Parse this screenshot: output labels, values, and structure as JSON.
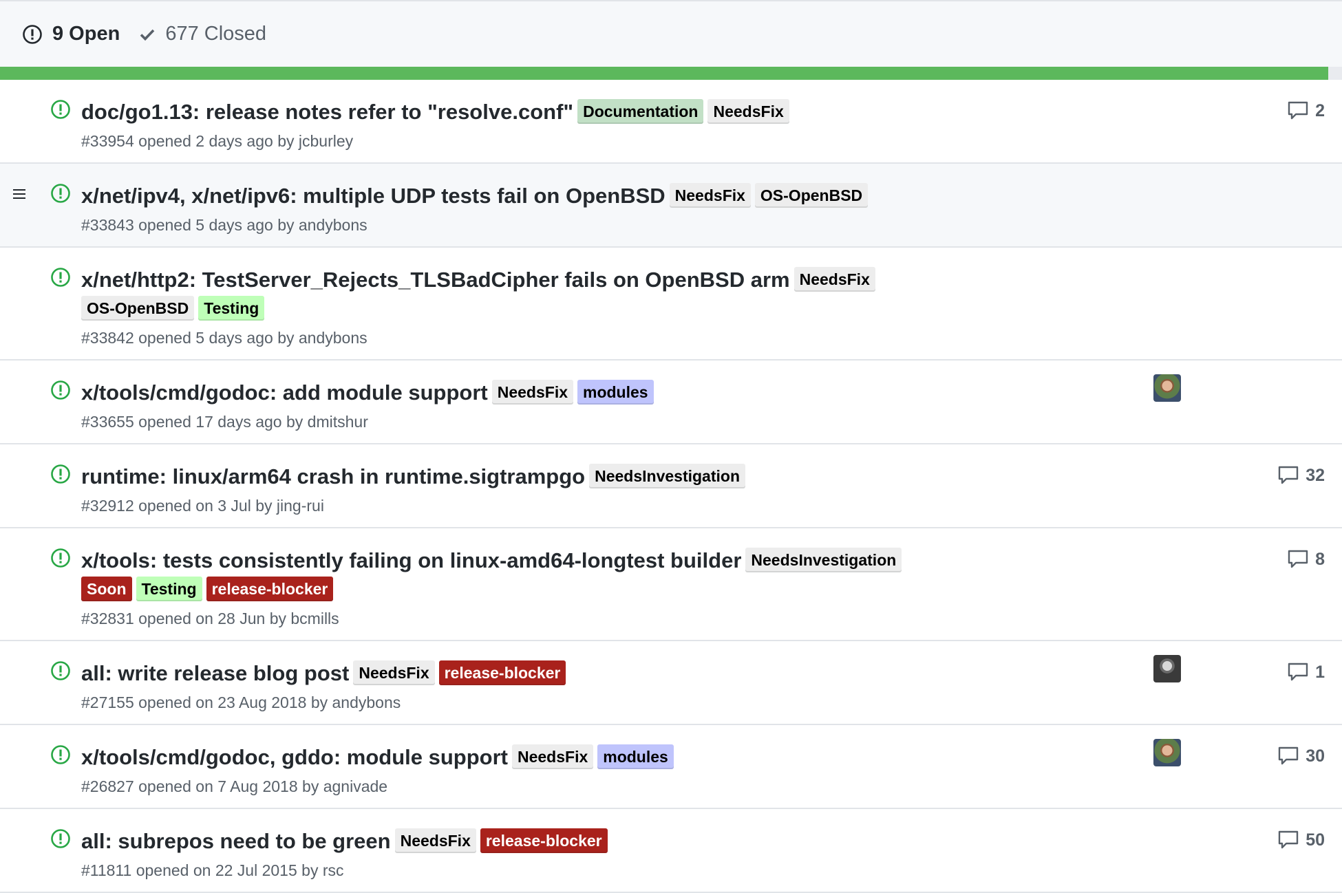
{
  "header": {
    "open_label": "9 Open",
    "closed_label": "677 Closed",
    "open_icon": "issue-opened-icon",
    "closed_icon": "check-icon"
  },
  "progress": {
    "closed_fraction": 0.9897,
    "fill_color": "#5cb85c"
  },
  "label_colors": {
    "Documentation": {
      "bg": "#c2e0c6",
      "fg": "#000000"
    },
    "NeedsFix": {
      "bg": "#ededed",
      "fg": "#000000"
    },
    "OS-OpenBSD": {
      "bg": "#ededed",
      "fg": "#000000"
    },
    "Testing": {
      "bg": "#bfffb8",
      "fg": "#000000"
    },
    "modules": {
      "bg": "#bfc4fc",
      "fg": "#000000"
    },
    "NeedsInvestigation": {
      "bg": "#ededed",
      "fg": "#000000"
    },
    "Soon": {
      "bg": "#a9221c",
      "fg": "#ffffff"
    },
    "release-blocker": {
      "bg": "#a9221c",
      "fg": "#ffffff"
    }
  },
  "issues": [
    {
      "title": "doc/go1.13: release notes refer to \"resolve.conf\"",
      "labels": [
        "Documentation",
        "NeedsFix"
      ],
      "meta": "#33954 opened 2 days ago by jcburley",
      "comments": "2",
      "avatar": null,
      "hover": false
    },
    {
      "title": "x/net/ipv4, x/net/ipv6: multiple UDP tests fail on OpenBSD",
      "labels": [
        "NeedsFix",
        "OS-OpenBSD"
      ],
      "meta": "#33843 opened 5 days ago by andybons",
      "comments": null,
      "avatar": null,
      "hover": true
    },
    {
      "title": "x/net/http2: TestServer_Rejects_TLSBadCipher fails on OpenBSD arm",
      "labels": [
        "NeedsFix",
        "OS-OpenBSD",
        "Testing"
      ],
      "wrap_after": 1,
      "meta": "#33842 opened 5 days ago by andybons",
      "comments": null,
      "avatar": null,
      "hover": false
    },
    {
      "title": "x/tools/cmd/godoc: add module support",
      "labels": [
        "NeedsFix",
        "modules"
      ],
      "meta": "#33655 opened 17 days ago by dmitshur",
      "comments": null,
      "avatar": "dmitshur",
      "hover": false
    },
    {
      "title": "runtime: linux/arm64 crash in runtime.sigtrampgo",
      "labels": [
        "NeedsInvestigation"
      ],
      "meta": "#32912 opened on 3 Jul by jing-rui",
      "comments": "32",
      "avatar": null,
      "hover": false
    },
    {
      "title": "x/tools: tests consistently failing on linux-amd64-longtest builder",
      "labels": [
        "NeedsInvestigation",
        "Soon",
        "Testing",
        "release-blocker"
      ],
      "wrap_after": 1,
      "meta": "#32831 opened on 28 Jun by bcmills",
      "comments": "8",
      "avatar": null,
      "hover": false
    },
    {
      "title": "all: write release blog post",
      "labels": [
        "NeedsFix",
        "release-blocker"
      ],
      "meta": "#27155 opened on 23 Aug 2018 by andybons",
      "comments": "1",
      "avatar": "andybons",
      "hover": false
    },
    {
      "title": "x/tools/cmd/godoc, gddo: module support",
      "labels": [
        "NeedsFix",
        "modules"
      ],
      "meta": "#26827 opened on 7 Aug 2018 by agnivade",
      "comments": "30",
      "avatar": "dmitshur",
      "hover": false
    },
    {
      "title": "all: subrepos need to be green",
      "labels": [
        "NeedsFix",
        "release-blocker"
      ],
      "meta": "#11811 opened on 22 Jul 2015 by rsc",
      "comments": "50",
      "avatar": null,
      "hover": false
    }
  ],
  "colors": {
    "open_icon": "#28a745",
    "title": "#24292e",
    "meta": "#586069",
    "border": "#e1e4e8",
    "header_bg": "#f6f8fa"
  }
}
